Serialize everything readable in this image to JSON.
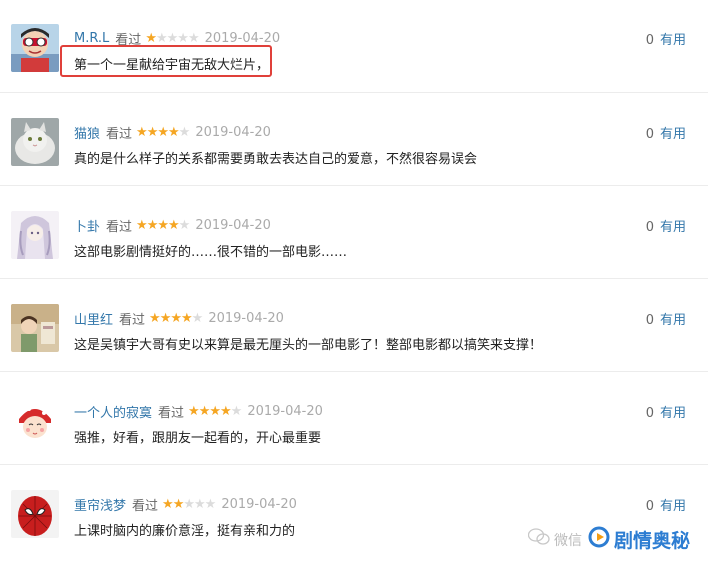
{
  "reviews": [
    {
      "username": "M.R.L",
      "watched": "看过",
      "rating": 1,
      "date": "2019-04-20",
      "useful_count": "0",
      "useful_label": "有用",
      "comment": "第一个一星献给宇宙无敌大烂片，"
    },
    {
      "username": "猫狼",
      "watched": "看过",
      "rating": 4,
      "date": "2019-04-20",
      "useful_count": "0",
      "useful_label": "有用",
      "comment": "真的是什么样子的关系都需要勇敢去表达自己的爱意，不然很容易误会"
    },
    {
      "username": "卜卦",
      "watched": "看过",
      "rating": 4,
      "date": "2019-04-20",
      "useful_count": "0",
      "useful_label": "有用",
      "comment": "这部电影剧情挺好的……很不错的一部电影……"
    },
    {
      "username": "山里红",
      "watched": "看过",
      "rating": 4,
      "date": "2019-04-20",
      "useful_count": "0",
      "useful_label": "有用",
      "comment": "这是吴镇宇大哥有史以来算是最无厘头的一部电影了！整部电影都以搞笑来支撑！"
    },
    {
      "username": "一个人的寂寞",
      "watched": "看过",
      "rating": 4,
      "date": "2019-04-20",
      "useful_count": "0",
      "useful_label": "有用",
      "comment": "强推，好看，跟朋友一起看的，开心最重要"
    },
    {
      "username": "重帘浅梦",
      "watched": "看过",
      "rating": 2,
      "date": "2019-04-20",
      "useful_count": "0",
      "useful_label": "有用",
      "comment": "上课时脑内的廉价意淫，挺有亲和力的"
    }
  ],
  "watermark": {
    "prefix": "微信",
    "brand": "剧情奥秘"
  },
  "colors": {
    "link": "#3377aa",
    "star_on": "#f5a623",
    "star_off": "#dcdcdc",
    "highlight": "#e0403a",
    "brand": "#2d7dd2"
  }
}
